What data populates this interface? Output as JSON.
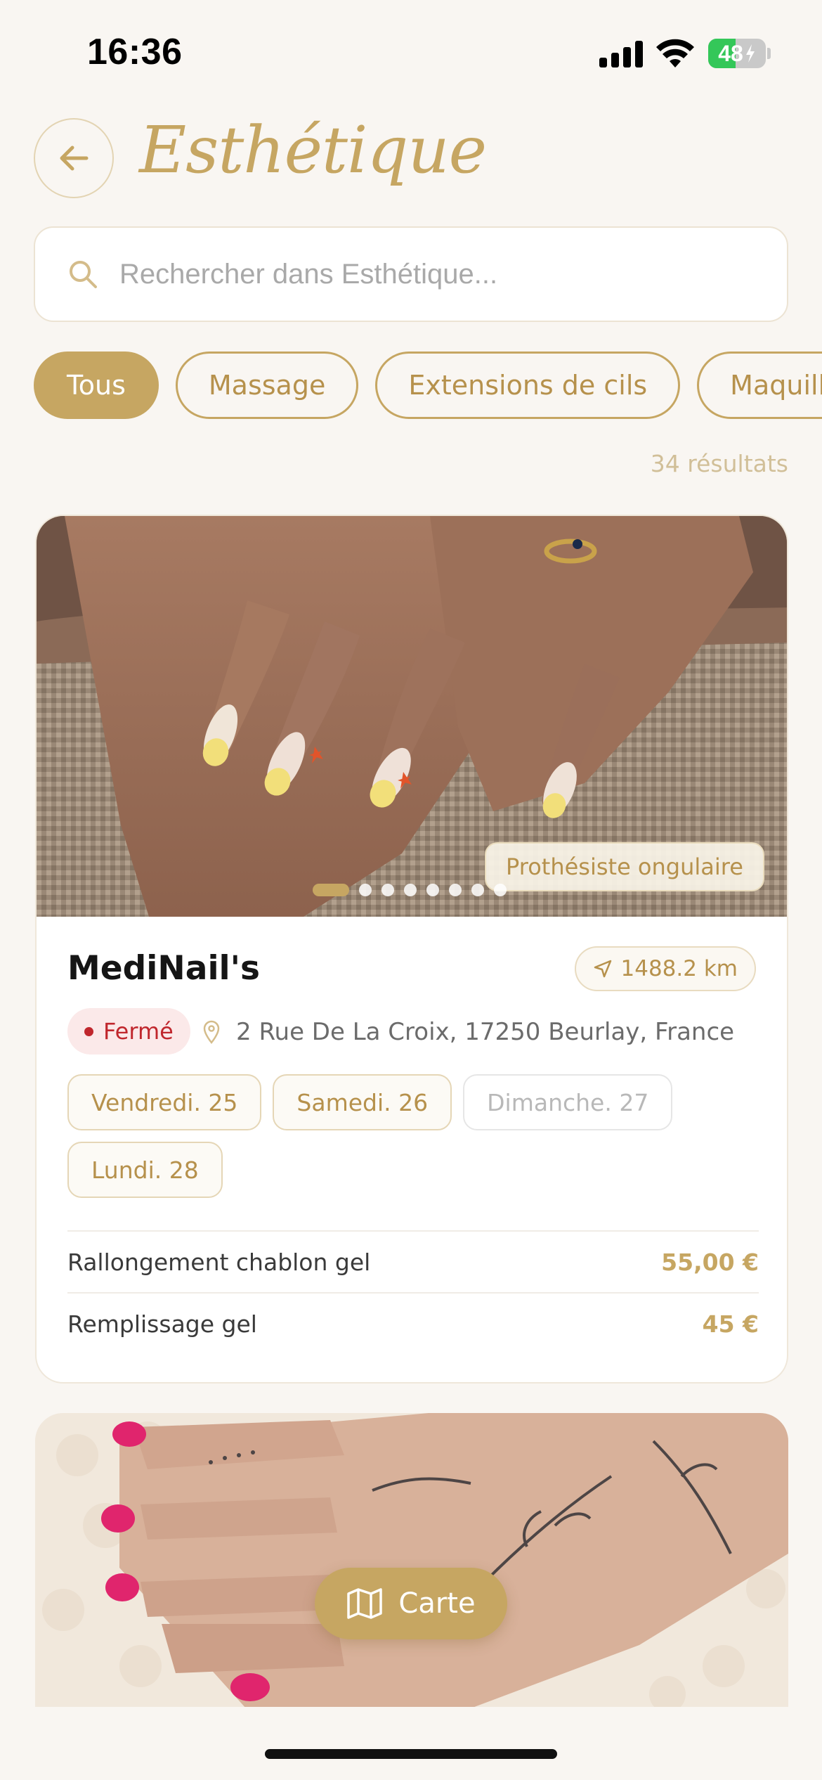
{
  "status_bar": {
    "time": "16:36",
    "battery": "48",
    "battery_level": 0.48,
    "icons": [
      "signal-icon",
      "wifi-icon",
      "battery-charging-icon"
    ]
  },
  "header": {
    "back_icon": "arrow-left-icon",
    "title": "Esthétique"
  },
  "search": {
    "placeholder": "Rechercher dans Esthétique..."
  },
  "filters": [
    {
      "label": "Tous",
      "active": true
    },
    {
      "label": "Massage",
      "active": false
    },
    {
      "label": "Extensions de cils",
      "active": false
    },
    {
      "label": "Maquilleuse",
      "active": false
    }
  ],
  "results": {
    "count": "34 résultats"
  },
  "listings": [
    {
      "category": "Prothésiste ongulaire",
      "name": "MediNail's",
      "distance": "1488.2 km",
      "status": "Fermé",
      "address": "2 Rue De La Croix, 17250 Beurlay, France",
      "image_count": 8,
      "active_image": 1,
      "days": [
        {
          "label": "Vendredi. 25",
          "available": true
        },
        {
          "label": "Samedi. 26",
          "available": true
        },
        {
          "label": "Dimanche. 27",
          "available": false
        },
        {
          "label": "Lundi. 28",
          "available": true
        }
      ],
      "services": [
        {
          "name": "Rallongement chablon gel",
          "price": "55,00 €"
        },
        {
          "name": "Remplissage gel",
          "price": "45 €"
        }
      ]
    }
  ],
  "map_button": {
    "label": "Carte",
    "icon": "map-icon"
  },
  "colors": {
    "accent": "#c6a662",
    "background": "#f9f6f2",
    "closed": "#c0272d"
  }
}
